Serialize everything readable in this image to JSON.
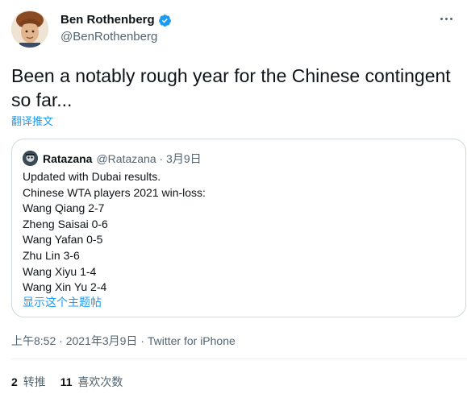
{
  "author": {
    "name": "Ben Rothenberg",
    "handle": "@BenRothenberg"
  },
  "tweet": {
    "text": "Been a notably rough year for the Chinese contingent so far...",
    "translate_label": "翻译推文"
  },
  "quote": {
    "name": "Ratazana",
    "meta": "@Ratazana · 3月9日",
    "lines": [
      "Updated with Dubai results.",
      "Chinese WTA players 2021 win-loss:",
      "Wang Qiang 2-7",
      "Zheng Saisai 0-6",
      "Wang Yafan 0-5",
      "Zhu Lin 3-6",
      "Wang Xiyu 1-4",
      "Wang Xin Yu 2-4"
    ],
    "show_thread": "显示这个主题帖"
  },
  "timestamp": "上午8:52 · 2021年3月9日 · Twitter for iPhone",
  "stats": {
    "retweets_count": "2",
    "retweets_label": "转推",
    "likes_count": "11",
    "likes_label": "喜欢次数"
  },
  "colors": {
    "accent": "#1d9bf0",
    "secondary_text": "#536471",
    "border": "#cfd9de"
  },
  "icons": [
    "verified-badge-icon",
    "more-options-icon"
  ]
}
